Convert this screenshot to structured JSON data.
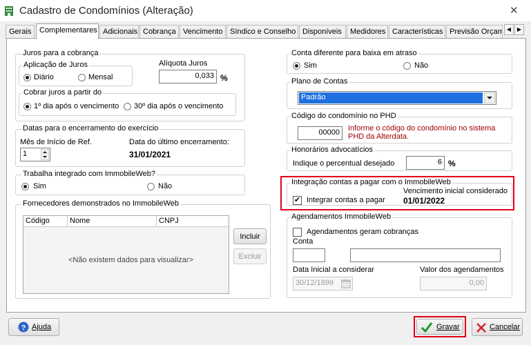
{
  "window": {
    "title": "Cadastro de Condomínios (Alteração)",
    "close_label": "✕"
  },
  "tabs": [
    {
      "label": "Gerais"
    },
    {
      "label": "Complementares"
    },
    {
      "label": "Adicionais"
    },
    {
      "label": "Cobrança"
    },
    {
      "label": "Vencimento"
    },
    {
      "label": "Síndico e Conselho"
    },
    {
      "label": "Disponíveis"
    },
    {
      "label": "Medidores"
    },
    {
      "label": "Características"
    },
    {
      "label": "Previsão Orçam"
    }
  ],
  "tab_scroll": {
    "left": "◀",
    "right": "▶"
  },
  "juros": {
    "legend": "Juros para a cobrança",
    "aplicacao": {
      "legend": "Aplicação de Juros",
      "diario": "Diário",
      "mensal": "Mensal"
    },
    "aliquota_label": "Alíquota Juros",
    "aliquota_value": "0,033",
    "percent": "%",
    "cobrar": {
      "legend": "Cobrar juros a partir do",
      "opt1": "1º dia após o vencimento",
      "opt2": "30º dia após o vencimento"
    }
  },
  "datas": {
    "legend": "Datas para o encerramento do exercício",
    "mes_label": "Mês de Início de Ref.",
    "mes_value": "1",
    "ultimo_label": "Data do último encerramento:",
    "ultimo_value": "31/01/2021"
  },
  "immobile": {
    "legend": "Trabalha integrado com ImmobileWeb?",
    "sim": "Sim",
    "nao": "Não"
  },
  "fornecedores": {
    "legend": "Fornecedores demonstrados no ImmobileWeb",
    "columns": [
      "Código",
      "Nome",
      "CNPJ"
    ],
    "empty": "<Não existem dados para visualizar>",
    "incluir": "Incluir",
    "excluir": "Excluir"
  },
  "conta_diferente": {
    "legend": "Conta diferente para baixa em atraso",
    "sim": "Sim",
    "nao": "Não"
  },
  "plano": {
    "legend": "Plano de Contas",
    "value": "Padrão"
  },
  "codigo_phd": {
    "legend": "Código do condomínio no PHD",
    "value": "00000",
    "hint": "Informe o código do condomínio no sistema PHD da Alterdata."
  },
  "honorarios": {
    "legend": "Honorários advocatícios",
    "label": "Indique o percentual desejado",
    "value": "6",
    "percent": "%"
  },
  "integracao": {
    "legend": "Integração contas a pagar com o ImmobileWeb",
    "checkbox_label": "Integrar contas a pagar",
    "venc_label": "Vencimento inicial considerado",
    "venc_value": "01/01/2022"
  },
  "agendamentos": {
    "legend": "Agendamentos ImmobileWeb",
    "checkbox_label": "Agendamentos geram cobranças",
    "conta_label": "Conta",
    "data_label": "Data Inicial a considerar",
    "data_value": "30/12/1899",
    "valor_label": "Valor dos agendamentos",
    "valor_value": "0,00"
  },
  "footer": {
    "ajuda": "Ajuda",
    "gravar": "Gravar",
    "cancelar": "Cancelar"
  },
  "colors": {
    "highlight_red": "#e2001a",
    "selection_blue": "#1e6fe0",
    "hint_red": "#a00000",
    "ok_green": "#1a9a2a"
  }
}
